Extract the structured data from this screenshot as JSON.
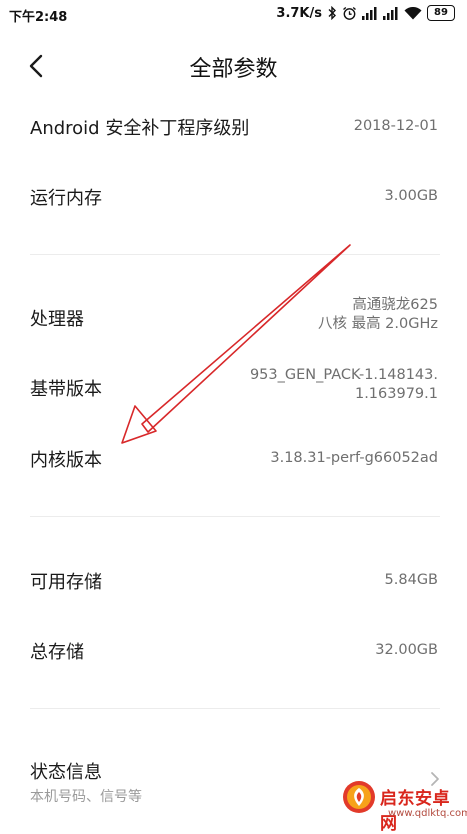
{
  "status_bar": {
    "time": "下午2:48",
    "network_speed": "3.7K/s",
    "battery_level": "89",
    "icons": [
      "bluetooth-icon",
      "alarm-icon",
      "signal-icon",
      "signal-icon",
      "wifi-icon",
      "battery-icon"
    ]
  },
  "header": {
    "title": "全部参数",
    "back_icon": "chevron-left-icon"
  },
  "sections": [
    {
      "rows": [
        {
          "label": "Android 安全补丁程序级别",
          "value": "2018-12-01"
        },
        {
          "label": "运行内存",
          "value": "3.00GB"
        }
      ]
    },
    {
      "rows": [
        {
          "label": "处理器",
          "value_line1": "高通骁龙625",
          "value_line2": "八核 最高 2.0GHz"
        },
        {
          "label": "基带版本",
          "value_line1": "953_GEN_PACK-1.148143.",
          "value_line2": "1.163979.1"
        },
        {
          "label": "内核版本",
          "value": "3.18.31-perf-g66052ad"
        }
      ]
    },
    {
      "rows": [
        {
          "label": "可用存储",
          "value": "5.84GB"
        },
        {
          "label": "总存储",
          "value": "32.00GB"
        }
      ]
    },
    {
      "rows": [
        {
          "label": "状态信息",
          "sublabel": "本机号码、信号等",
          "chevron": "chevron-right-icon"
        }
      ]
    }
  ],
  "annotation": {
    "arrow_color": "#d8282a"
  },
  "watermark": {
    "text": "启东安卓网",
    "url": "www.qdlktq.com"
  }
}
